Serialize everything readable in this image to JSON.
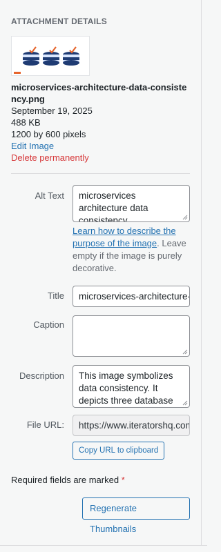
{
  "header": {
    "title": "ATTACHMENT DETAILS"
  },
  "file": {
    "name": "microservices-architecture-data-consistency.png",
    "date": "September 19, 2025",
    "size": "488 KB",
    "dimensions": "1200 by 600 pixels",
    "edit_label": "Edit Image",
    "delete_label": "Delete permanently"
  },
  "fields": {
    "alt_text": {
      "label": "Alt Text",
      "value": "microservices architecture data consistency",
      "help_link": "Learn how to describe the purpose of the image",
      "help_rest": ". Leave empty if the image is purely decorative."
    },
    "title": {
      "label": "Title",
      "value": "microservices-architecture-data-consistency"
    },
    "caption": {
      "label": "Caption",
      "value": ""
    },
    "description": {
      "label": "Description",
      "value": "This image symbolizes data consistency. It depicts three database"
    },
    "file_url": {
      "label": "File URL:",
      "value": "https://www.iteratorshq.com",
      "copy_label": "Copy URL to clipboard"
    }
  },
  "required_note": {
    "text": "Required fields are marked",
    "star": "*"
  },
  "regenerate_label": "Regenerate Thumbnails",
  "colors": {
    "link": "#2271b1",
    "danger": "#d63638",
    "check": "#e6642b",
    "db_dark": "#1f3b73"
  }
}
